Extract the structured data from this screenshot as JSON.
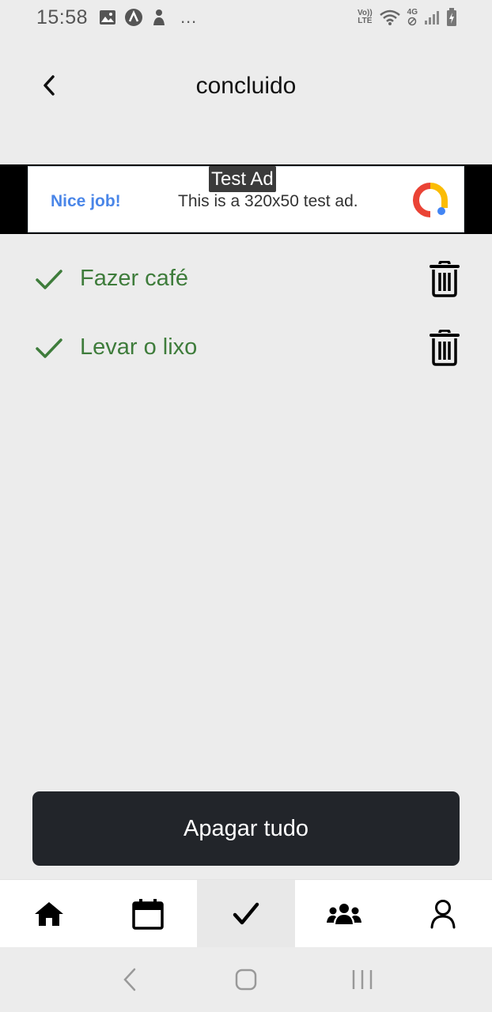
{
  "status_bar": {
    "time": "15:58",
    "volte_label_top": "Vo))",
    "volte_label_bottom": "LTE",
    "network_label": "4G",
    "more_label": "…"
  },
  "header": {
    "title": "concluido",
    "back_icon": "chevron-left-icon"
  },
  "ad": {
    "label": "Test Ad",
    "headline": "Nice job!",
    "body": "This is a 320x50 test ad."
  },
  "todos": [
    {
      "label": "Fazer café",
      "done": true
    },
    {
      "label": "Levar o lixo",
      "done": true
    }
  ],
  "actions": {
    "delete_all_label": "Apagar tudo"
  },
  "bottom_nav": {
    "items": [
      {
        "icon": "home-icon",
        "active": false
      },
      {
        "icon": "calendar-icon",
        "active": false
      },
      {
        "icon": "check-icon",
        "active": true
      },
      {
        "icon": "group-icon",
        "active": false
      },
      {
        "icon": "user-icon",
        "active": false
      }
    ]
  },
  "colors": {
    "done_green": "#3e7c3b",
    "button_dark": "#22252a",
    "background": "#ececec",
    "ad_blue": "#4a86e8"
  }
}
